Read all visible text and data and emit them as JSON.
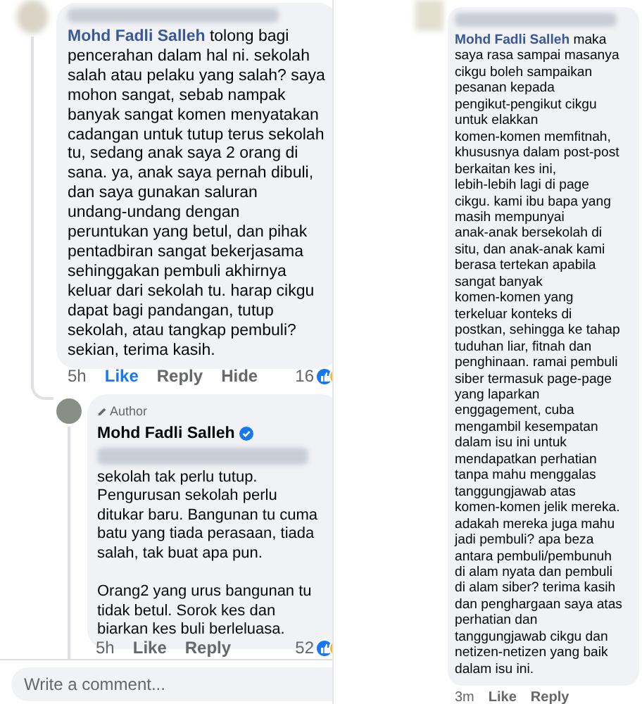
{
  "left": {
    "comment": {
      "author": "Mohd Fadli Salleh",
      "text": "tolong bagi\npencerahan dalam hal ni. sekolah\nsalah atau pelaku yang salah? saya\nmohon sangat, sebab nampak\nbanyak sangat komen menyatakan\ncadangan untuk tutup terus sekolah\ntu, sedang anak saya 2 orang di\nsana. ya, anak saya pernah dibuli,\ndan saya gunakan saluran\nundang-undang dengan\nperuntukan yang betul, dan pihak\npentadbiran sangat bekerjasama\nsehinggakan pembuli akhirnya\nkeluar dari sekolah tu. harap cikgu\ndapat bagi pandangan, tutup\nsekolah, atau tangkap pembuli?\nsekian, terima kasih.",
      "liked": true,
      "actions": [
        {
          "kind": "time",
          "label": "5h"
        },
        {
          "kind": "like",
          "label": "Like"
        },
        {
          "kind": "reply",
          "label": "Reply"
        },
        {
          "kind": "hide",
          "label": "Hide"
        }
      ],
      "reaction_count": "16"
    },
    "reply": {
      "badge": "Author",
      "author": "Mohd Fadli Salleh",
      "verified": true,
      "liked": false,
      "paragraphs": [
        "sekolah tak perlu tutup.\nPengurusan sekolah perlu\nditukar baru. Bangunan tu cuma\nbatu yang tiada perasaan, tiada\nsalah, tak buat apa pun.",
        "Orang2 yang urus bangunan tu\ntidak betul. Sorok kes dan\nbiarkan kes buli berleluasa."
      ],
      "actions": [
        {
          "kind": "time",
          "label": "5h"
        },
        {
          "kind": "like",
          "label": "Like"
        },
        {
          "kind": "reply",
          "label": "Reply"
        }
      ],
      "reaction_count": "52"
    },
    "composer": {
      "placeholder": "Write a comment..."
    }
  },
  "right": {
    "comment": {
      "author": "Mohd Fadli Salleh",
      "text": "maka\nsaya rasa sampai masanya\ncikgu boleh sampaikan\npesanan kepada\npengikut-pengikut cikgu\nuntuk elakkan\nkomen-komen memfitnah,\nkhususnya dalam post-post\nberkaitan kes ini,\nlebih-lebih lagi di page\ncikgu. kami ibu bapa yang\nmasih mempunyai\nanak-anak bersekolah di\nsitu, dan anak-anak kami\nberasa tertekan apabila\nsangat banyak\nkomen-komen yang\nterkeluar konteks di\npostkan, sehingga ke tahap\ntuduhan liar, fitnah dan\npenghinaan. ramai pembuli\nsiber termasuk page-page\nyang laparkan\nenggagement, cuba\nmengambil kesempatan\ndalam isu ini untuk\nmendapatkan perhatian\ntanpa mahu menggalas\ntanggungjawab atas\nkomen-komen jelik mereka.\nadakah mereka juga mahu\njadi pembuli? apa beza\nantara pembuli/pembunuh\ndi alam nyata dan pembuli\ndi alam siber? terima kasih\ndan penghargaan saya atas\nperhatian dan\ntanggungjawab cikgu dan\nnetizen-netizen yang baik\ndalam isu ini.",
      "liked": false,
      "actions": [
        {
          "kind": "time",
          "label": "3m"
        },
        {
          "kind": "like",
          "label": "Like"
        },
        {
          "kind": "reply",
          "label": "Reply"
        }
      ]
    }
  }
}
